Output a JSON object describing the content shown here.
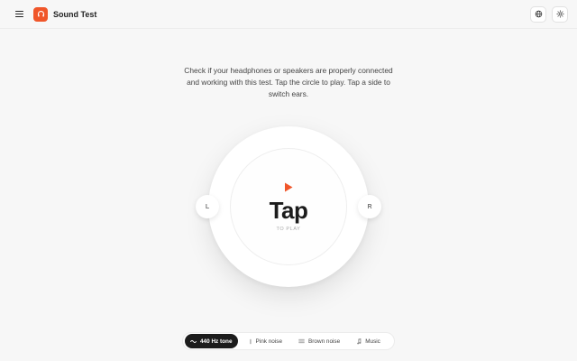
{
  "header": {
    "app_title": "Sound Test",
    "menu_icon": "hamburger-icon",
    "logo_icon": "headphones-icon",
    "language_icon": "globe-icon",
    "theme_icon": "sun-icon"
  },
  "main": {
    "description": "Check if your headphones or speakers are properly connected and working with this test. Tap the circle to play. Tap a side to switch ears.",
    "tap_label": "Tap",
    "tap_sub_label": "TO PLAY",
    "left_label": "L",
    "right_label": "R"
  },
  "sound_options": [
    {
      "label": "440 Hz tone",
      "icon": "sine-wave-icon",
      "active": true
    },
    {
      "label": "Pink noise",
      "icon": "bar-icon",
      "active": false
    },
    {
      "label": "Brown noise",
      "icon": "lines-icon",
      "active": false
    },
    {
      "label": "Music",
      "icon": "music-note-icon",
      "active": false
    }
  ],
  "colors": {
    "accent": "#f0562a",
    "background": "#f7f7f7",
    "active_pill": "#1c1c1c"
  }
}
